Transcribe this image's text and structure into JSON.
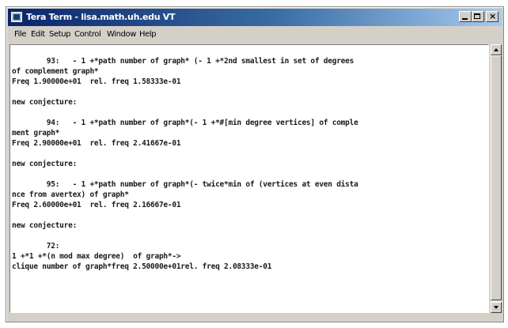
{
  "window": {
    "title": "Tera Term - lisa.math.uh.edu VT"
  },
  "menubar": {
    "items": [
      "File",
      "Edit",
      "Setup",
      "Control",
      "Window",
      "Help"
    ]
  },
  "terminal": {
    "lines": [
      "        93:   - 1 +*path number of graph* (- 1 +*2nd smallest in set of degrees",
      "of complement graph*",
      "Freq 1.90000e+01  rel. freq 1.58333e-01",
      "",
      "new conjecture:",
      "",
      "        94:   - 1 +*path number of graph*(- 1 +*#[min degree vertices] of comple",
      "ment graph*",
      "Freq 2.90000e+01  rel. freq 2.41667e-01",
      "",
      "new conjecture:",
      "",
      "        95:   - 1 +*path number of graph*(- twice*min of (vertices at even dista",
      "nce from avertex) of graph*",
      "Freq 2.60000e+01  rel. freq 2.16667e-01",
      "",
      "new conjecture:",
      "",
      "        72:",
      "1 +*1 +*(n mod max degree)  of graph*->",
      "clique number of graph*freq 2.50000e+01rel. freq 2.08333e-01"
    ]
  }
}
